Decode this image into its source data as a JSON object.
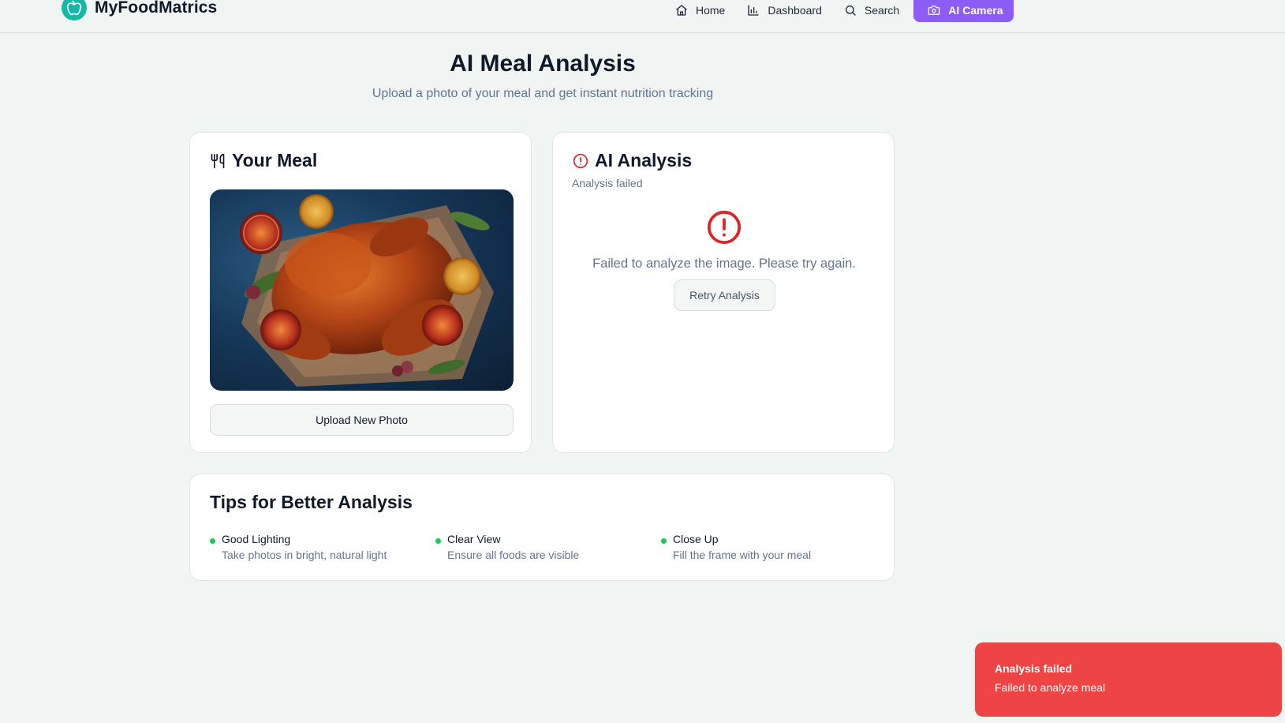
{
  "brand": {
    "name": "MyFoodMatrics",
    "logo_icon": "apple-icon",
    "accent": "#14b8a6"
  },
  "nav": {
    "items": [
      {
        "label": "Home",
        "icon": "home-icon"
      },
      {
        "label": "Dashboard",
        "icon": "bar-chart-icon"
      },
      {
        "label": "Search",
        "icon": "search-icon"
      },
      {
        "label": "AI Camera",
        "icon": "camera-icon",
        "active": true
      }
    ],
    "active_color": "#8b5cf6"
  },
  "page": {
    "title": "AI Meal Analysis",
    "subtitle": "Upload a photo of your meal and get instant nutrition tracking"
  },
  "meal_card": {
    "title": "Your Meal",
    "icon": "utensils-icon",
    "photo_alt": "roasted-chicken-with-blood-oranges",
    "upload_label": "Upload New Photo"
  },
  "ai_card": {
    "title": "AI Analysis",
    "icon": "alert-circle-icon",
    "status": "Analysis failed",
    "error_message": "Failed to analyze the image. Please try again.",
    "retry_label": "Retry Analysis",
    "error_color": "#dc2626"
  },
  "tips": {
    "title": "Tips for Better Analysis",
    "items": [
      {
        "label": "Good Lighting",
        "desc": "Take photos in bright, natural light"
      },
      {
        "label": "Clear View",
        "desc": "Ensure all foods are visible"
      },
      {
        "label": "Close Up",
        "desc": "Fill the frame with your meal"
      }
    ],
    "dot_color": "#22c55e"
  },
  "toast": {
    "title": "Analysis failed",
    "description": "Failed to analyze meal",
    "color": "#ef4444"
  }
}
